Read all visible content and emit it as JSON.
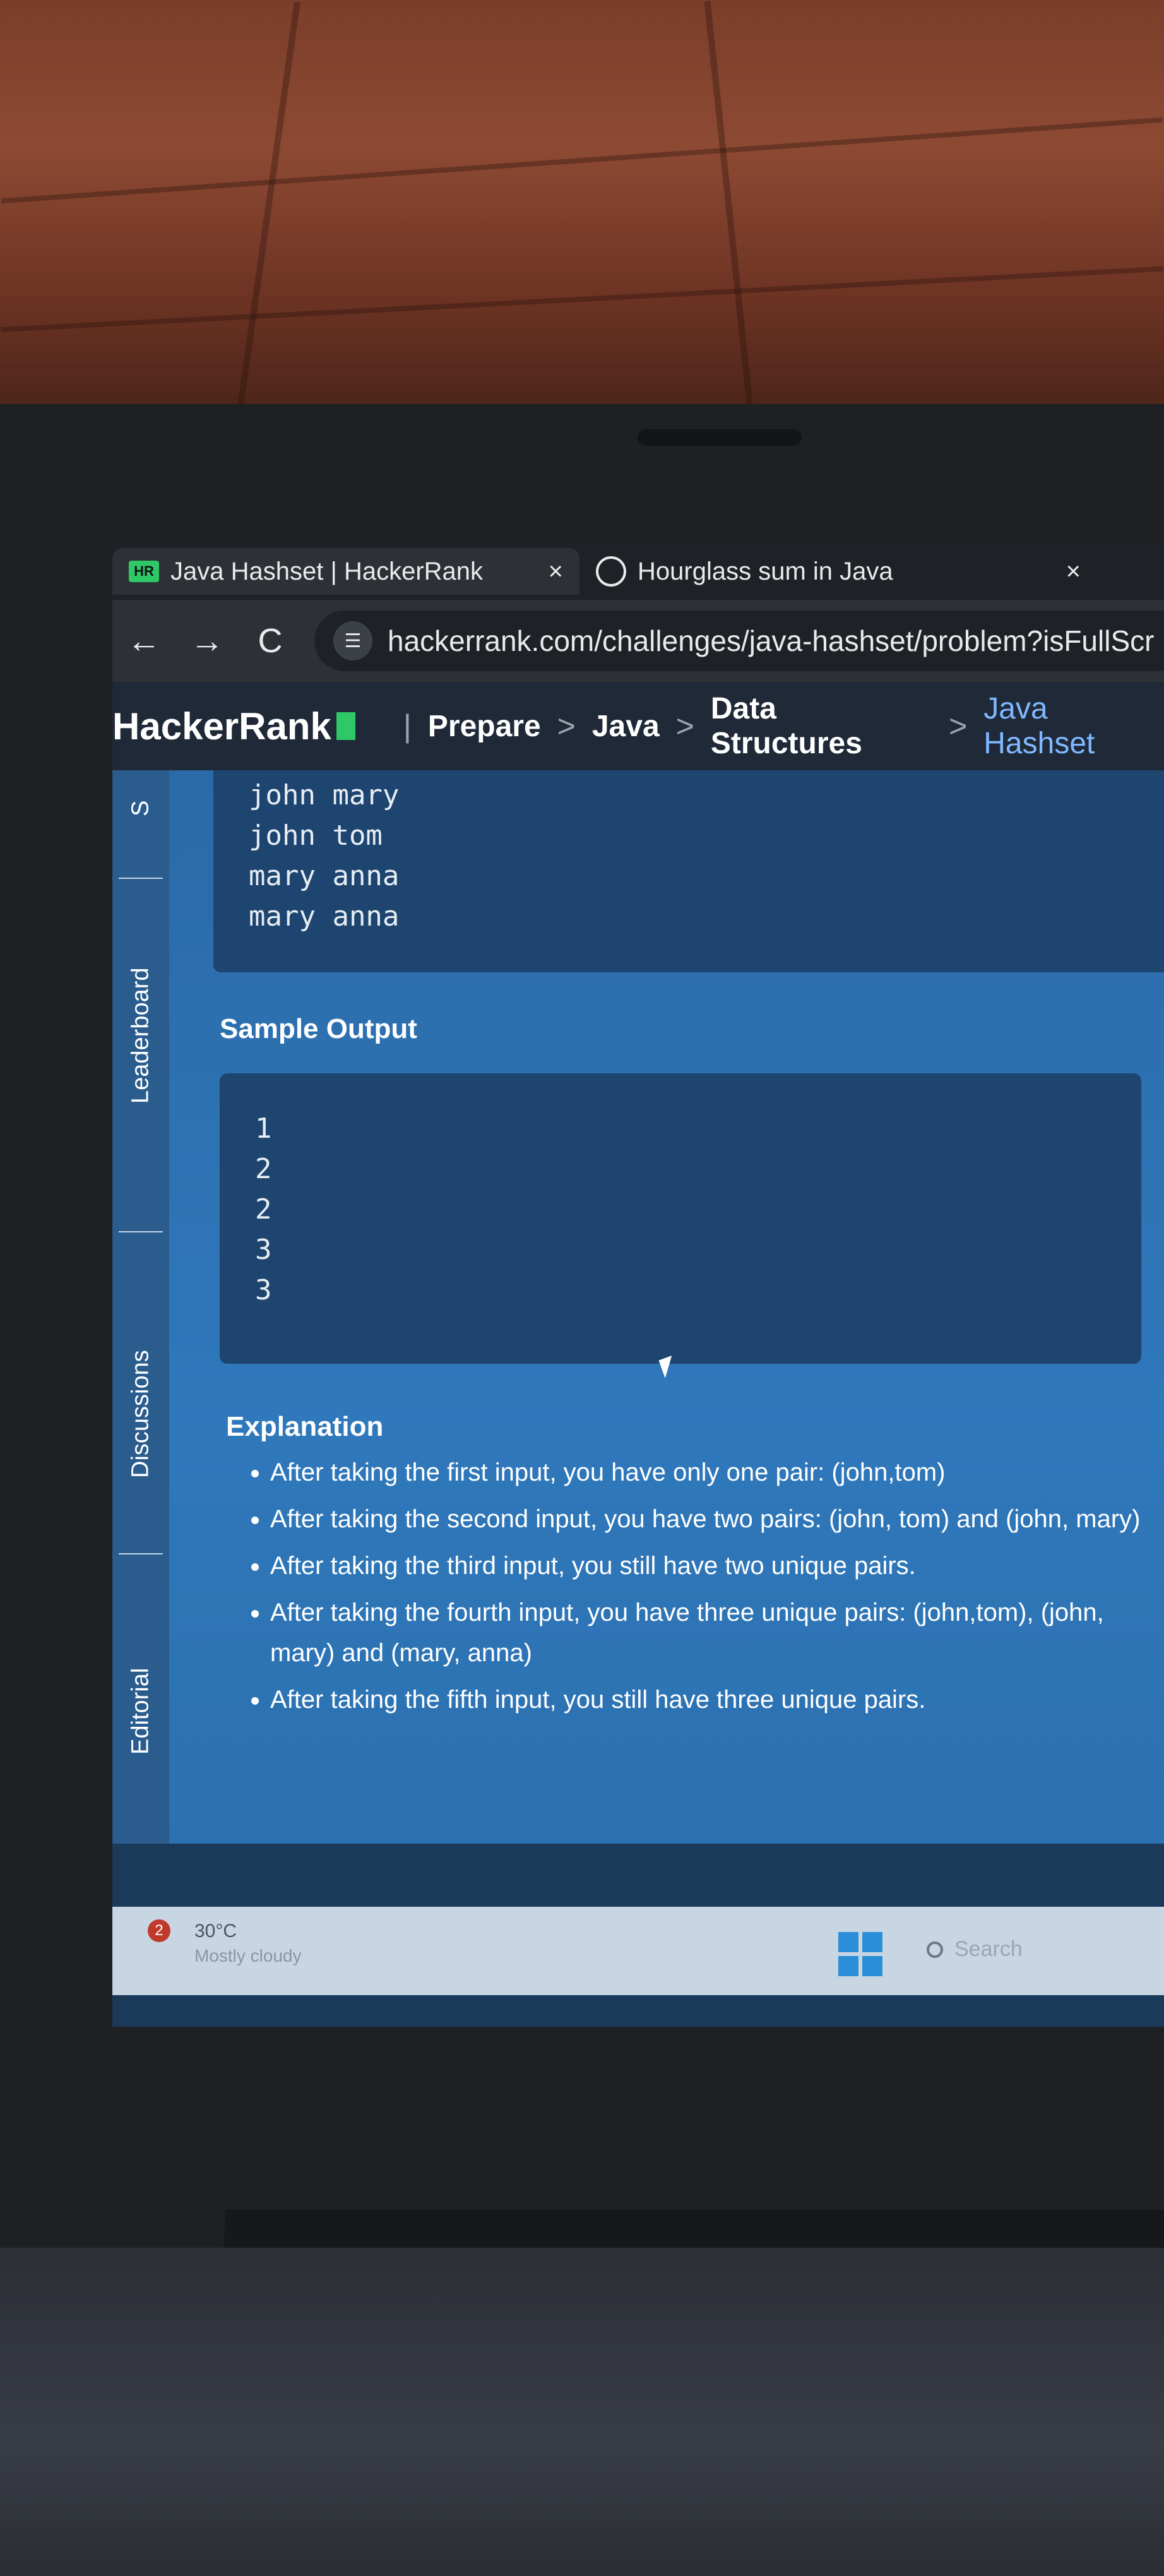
{
  "browser": {
    "tabs": [
      {
        "label": "Java Hashset | HackerRank",
        "favicon_text": "HR",
        "active": true
      },
      {
        "label": "Hourglass sum in Java",
        "active": false
      }
    ],
    "close_glyph": "×",
    "url": "hackerrank.com/challenges/java-hashset/problem?isFullScr",
    "nav": {
      "back": "←",
      "forward": "→",
      "reload": "C"
    }
  },
  "site": {
    "logo": "HackerRank",
    "divider": "|",
    "breadcrumbs": [
      "Prepare",
      "Java",
      "Data Structures",
      "Java Hashset"
    ],
    "breadcrumb_sep": ">"
  },
  "rail": {
    "items": [
      "S",
      "Leaderboard",
      "Discussions",
      "Editorial"
    ]
  },
  "problem": {
    "sample_input_tail": [
      "john mary",
      "john tom",
      "mary anna",
      "mary anna"
    ],
    "sample_output_heading": "Sample Output",
    "sample_output": [
      "1",
      "2",
      "2",
      "3",
      "3"
    ],
    "explanation_heading": "Explanation",
    "explanation": [
      "After taking the first input, you have only one pair: (john,tom)",
      "After taking the second input, you have two pairs: (john, tom) and (john, mary)",
      "After taking the third input, you still have two unique pairs.",
      "After taking the fourth input, you have three unique pairs: (john,tom), (john, mary) and (mary, anna)",
      "After taking the fifth input, you still have three unique pairs."
    ]
  },
  "taskbar": {
    "weather_badge": "2",
    "temperature": "30°C",
    "condition": "Mostly cloudy",
    "search_placeholder": "Search"
  }
}
